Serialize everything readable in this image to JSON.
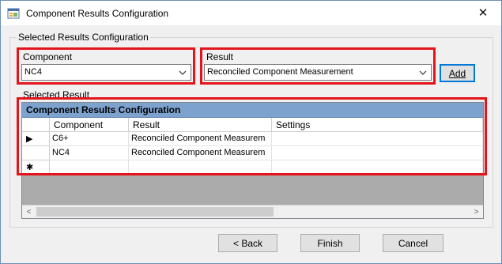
{
  "window": {
    "title": "Component Results Configuration",
    "close_glyph": "✕",
    "icon": "form-icon"
  },
  "group": {
    "label": "Selected Results Configuration"
  },
  "component": {
    "label": "Component",
    "value": "NC4"
  },
  "result": {
    "label": "Result",
    "value": "Reconciled Component Measurement"
  },
  "add_button": "Add",
  "selected_result_label": "Selected Result",
  "grid": {
    "caption": "Component Results Configuration",
    "columns": [
      "Component",
      "Result",
      "Settings"
    ],
    "rows": [
      {
        "indicator": "▶",
        "component": "C6+",
        "result": "Reconciled Component Measurem",
        "settings": ""
      },
      {
        "indicator": "",
        "component": "NC4",
        "result": "Reconciled Component Measurem",
        "settings": ""
      },
      {
        "indicator": "✱",
        "component": "",
        "result": "",
        "settings": ""
      }
    ]
  },
  "buttons": {
    "back": "< Back",
    "finish": "Finish",
    "cancel": "Cancel"
  },
  "colors": {
    "highlight": "#e3141b",
    "caption_bg": "#7da2ce",
    "grid_bg": "#ababab"
  }
}
